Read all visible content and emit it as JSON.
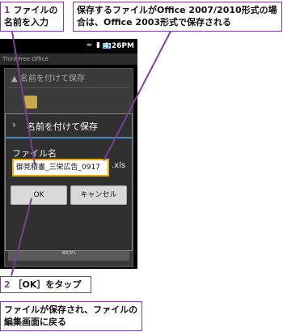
{
  "callouts": {
    "step1_num": "1",
    "step1_text": "ファイルの名前を入力",
    "top_note": "保存するファイルがOffice 2007/2010形式の場合は、Office 2003形式で保存される",
    "step2_num": "2",
    "step2_text": "［OK］をタップ",
    "result_note": "ファイルが保存され、ファイルの編集画面に戻る"
  },
  "statusbar": {
    "time": "4:26PM"
  },
  "app": {
    "title": "ThinkFree Office"
  },
  "background_dialog": {
    "title": "名前を付けて保存",
    "select_button": "選択"
  },
  "dialog": {
    "title": "名前を付けて保存",
    "filename_label": "ファイル名",
    "filename_value": "御見積書_三栄広告_0917",
    "extension": ".xls",
    "ok_label": "OK",
    "cancel_label": "キャンセル"
  },
  "colors": {
    "callout_border": "#7b3f98",
    "input_focus": "#f2a900",
    "title_underline": "#3b8fd1"
  }
}
